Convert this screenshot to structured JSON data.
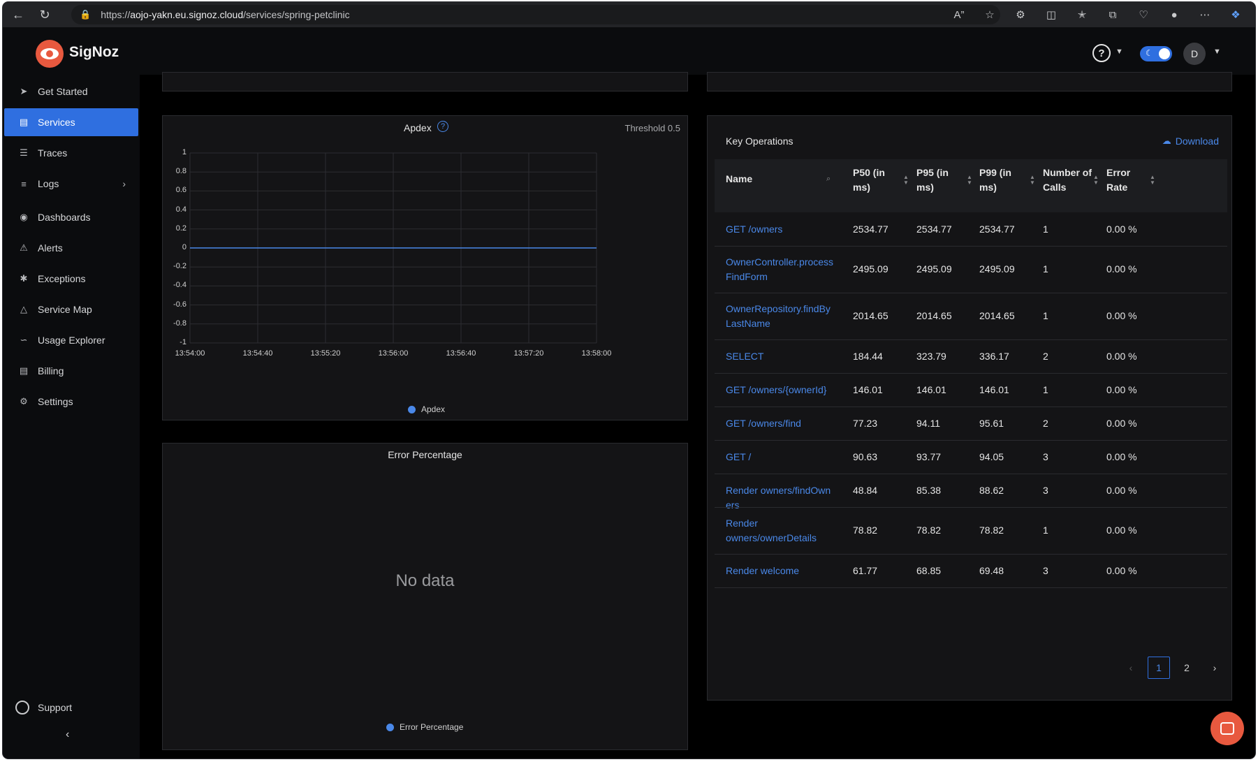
{
  "browser": {
    "url_prefix": "https://",
    "url_host": "aojo-yakn.eu.signoz.cloud",
    "url_path": "/services/spring-petclinic"
  },
  "app": {
    "brand": "SigNoz",
    "avatar_initial": "D"
  },
  "sidebar": {
    "items": [
      {
        "label": "Get Started",
        "icon": "rocket-icon"
      },
      {
        "label": "Services",
        "icon": "bar-chart-icon"
      },
      {
        "label": "Traces",
        "icon": "list-icon"
      },
      {
        "label": "Logs",
        "icon": "align-left-icon"
      },
      {
        "label": "Dashboards",
        "icon": "dashboard-icon"
      },
      {
        "label": "Alerts",
        "icon": "bell-icon"
      },
      {
        "label": "Exceptions",
        "icon": "bug-icon"
      },
      {
        "label": "Service Map",
        "icon": "map-icon"
      },
      {
        "label": "Usage Explorer",
        "icon": "line-chart-icon"
      },
      {
        "label": "Billing",
        "icon": "file-icon"
      },
      {
        "label": "Settings",
        "icon": "gear-icon"
      }
    ],
    "support_label": "Support"
  },
  "apdex": {
    "title": "Apdex",
    "threshold": "Threshold 0.5",
    "legend": "Apdex",
    "chart_data": {
      "type": "line",
      "x": [
        "13:54:00",
        "13:54:40",
        "13:55:20",
        "13:56:00",
        "13:56:40",
        "13:57:20",
        "13:58:00"
      ],
      "y_ticks": [
        "1",
        "0.8",
        "0.6",
        "0.4",
        "0.2",
        "0",
        "-0.2",
        "-0.4",
        "-0.6",
        "-0.8",
        "-1"
      ],
      "series": [
        {
          "name": "Apdex",
          "values": [
            0,
            0,
            0,
            0,
            0,
            0,
            0
          ]
        }
      ],
      "ylim": [
        -1,
        1
      ],
      "grid": true,
      "legend_position": "bottom",
      "color": "#4a88e8"
    }
  },
  "error_percentage": {
    "title": "Error Percentage",
    "nodata": "No data",
    "legend": "Error Percentage"
  },
  "key_operations": {
    "title": "Key Operations",
    "download": "Download",
    "columns": [
      "Name",
      "P50 (in ms)",
      "P95 (in ms)",
      "P99 (in ms)",
      "Number of Calls",
      "Error Rate"
    ],
    "rows": [
      {
        "name": "GET /owners",
        "p50": "2534.77",
        "p95": "2534.77",
        "p99": "2534.77",
        "calls": "1",
        "error": "0.00 %"
      },
      {
        "name": "OwnerController.processFindForm",
        "p50": "2495.09",
        "p95": "2495.09",
        "p99": "2495.09",
        "calls": "1",
        "error": "0.00 %"
      },
      {
        "name": "OwnerRepository.findByLastName",
        "p50": "2014.65",
        "p95": "2014.65",
        "p99": "2014.65",
        "calls": "1",
        "error": "0.00 %"
      },
      {
        "name": "SELECT",
        "p50": "184.44",
        "p95": "323.79",
        "p99": "336.17",
        "calls": "2",
        "error": "0.00 %"
      },
      {
        "name": "GET /owners/{ownerId}",
        "p50": "146.01",
        "p95": "146.01",
        "p99": "146.01",
        "calls": "1",
        "error": "0.00 %"
      },
      {
        "name": "GET /owners/find",
        "p50": "77.23",
        "p95": "94.11",
        "p99": "95.61",
        "calls": "2",
        "error": "0.00 %"
      },
      {
        "name": "GET /",
        "p50": "90.63",
        "p95": "93.77",
        "p99": "94.05",
        "calls": "3",
        "error": "0.00 %"
      },
      {
        "name": "Render owners/findOwners",
        "p50": "48.84",
        "p95": "85.38",
        "p99": "88.62",
        "calls": "3",
        "error": "0.00 %"
      },
      {
        "name": "Render owners/ownerDetails",
        "p50": "78.82",
        "p95": "78.82",
        "p99": "78.82",
        "calls": "1",
        "error": "0.00 %"
      },
      {
        "name": "Render welcome",
        "p50": "61.77",
        "p95": "68.85",
        "p99": "69.48",
        "calls": "3",
        "error": "0.00 %"
      }
    ],
    "pages": [
      "1",
      "2"
    ]
  }
}
